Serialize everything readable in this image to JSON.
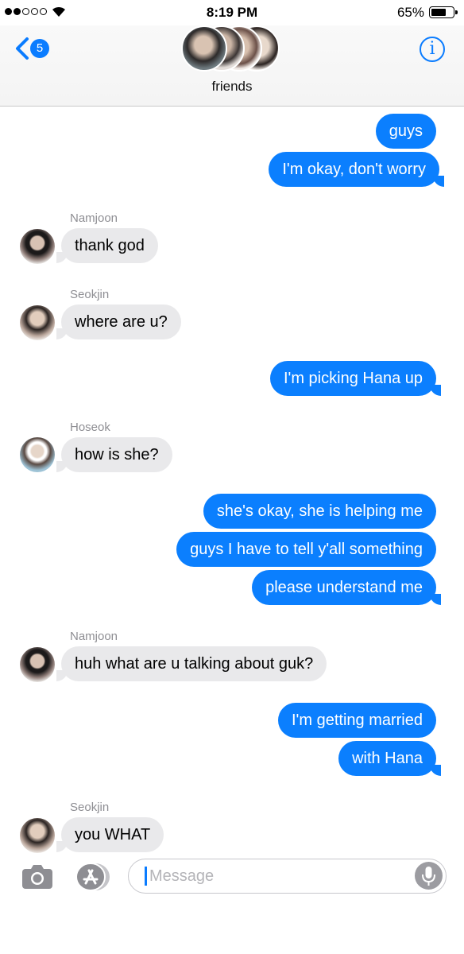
{
  "status_bar": {
    "time": "8:19 PM",
    "battery": "65%"
  },
  "header": {
    "back_badge": "5",
    "group_name": "friends",
    "info_label": "i"
  },
  "messages": [
    {
      "from": "me",
      "text": "guys"
    },
    {
      "from": "me",
      "text": "I'm okay, don't worry"
    },
    {
      "from": "Namjoon",
      "sender_label": "Namjoon",
      "text": "thank god"
    },
    {
      "from": "Seokjin",
      "sender_label": "Seokjin",
      "text": "where are u?"
    },
    {
      "from": "me",
      "text": "I'm picking Hana up"
    },
    {
      "from": "Hoseok",
      "sender_label": "Hoseok",
      "text": "how is she?"
    },
    {
      "from": "me",
      "text": "she's okay, she is helping me"
    },
    {
      "from": "me",
      "text": "guys I have to tell y'all something"
    },
    {
      "from": "me",
      "text": "please understand me"
    },
    {
      "from": "Namjoon",
      "sender_label": "Namjoon",
      "text": "huh what are u talking about guk?"
    },
    {
      "from": "me",
      "text": "I'm getting married"
    },
    {
      "from": "me",
      "text": "with Hana"
    },
    {
      "from": "Seokjin",
      "sender_label": "Seokjin",
      "text": "you WHAT"
    }
  ],
  "input": {
    "placeholder": "Message"
  },
  "colors": {
    "outgoing_bubble": "#0b7ffe",
    "incoming_bubble": "#e9e9eb",
    "accent": "#0a7cff"
  },
  "icons": [
    "back-chevron-icon",
    "info-icon",
    "camera-icon",
    "app-store-icon",
    "microphone-icon",
    "wifi-icon"
  ]
}
